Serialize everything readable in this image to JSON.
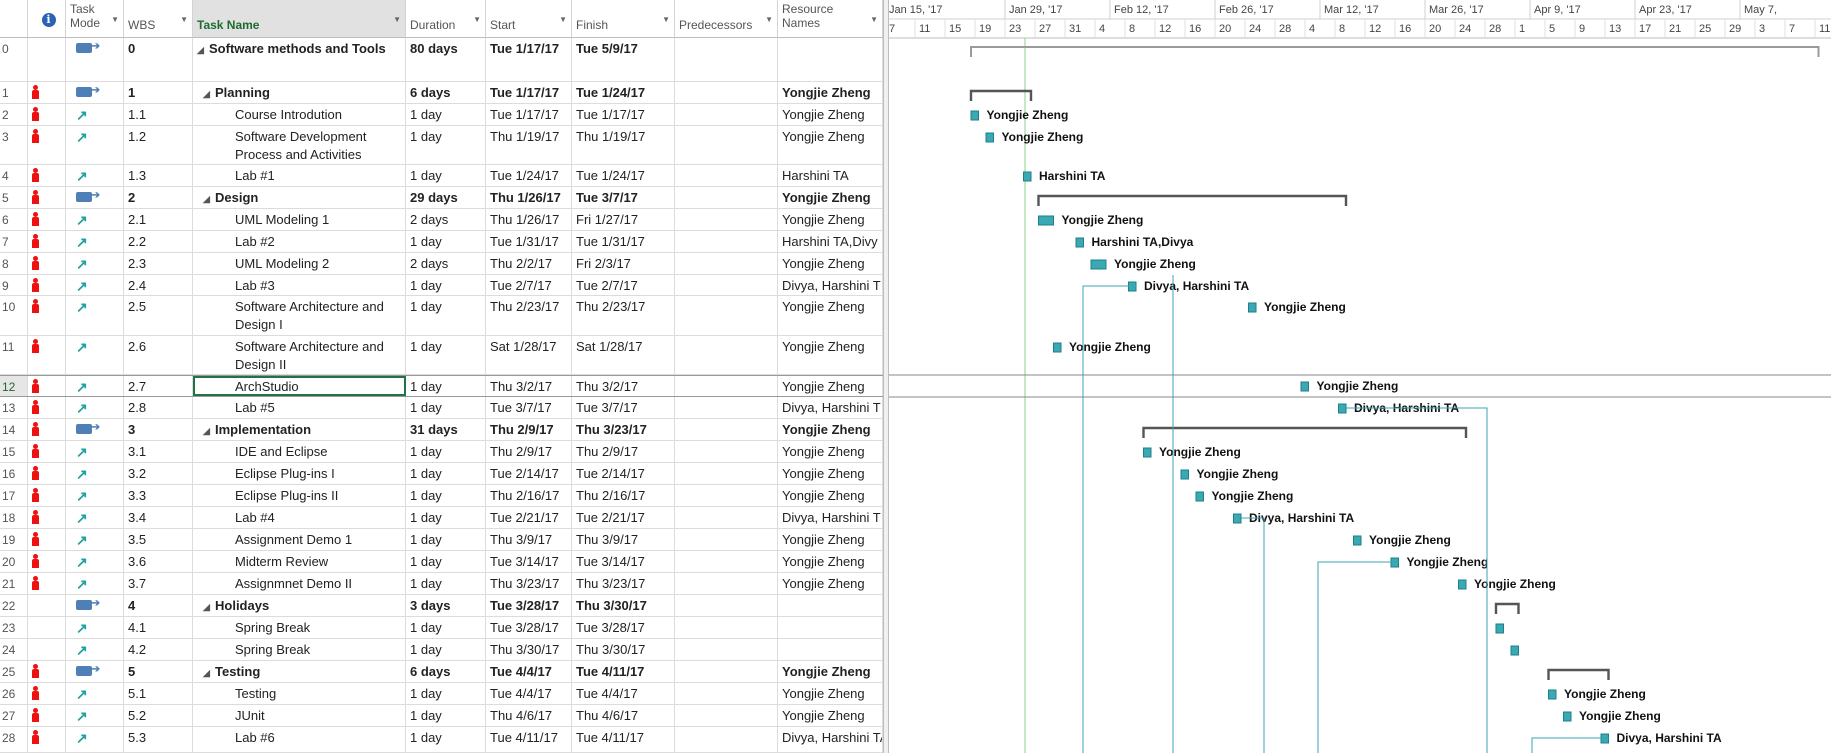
{
  "columns": {
    "task_mode": "Task Mode",
    "wbs": "WBS",
    "task_name": "Task Name",
    "duration": "Duration",
    "start": "Start",
    "finish": "Finish",
    "predecessors": "Predecessors",
    "resource_names": "Resource Names"
  },
  "timeline": {
    "major": [
      "Jan 15, '17",
      "Jan 29, '17",
      "Feb 12, '17",
      "Feb 26, '17",
      "Mar 12, '17",
      "Mar 26, '17",
      "Apr 9, '17",
      "Apr 23, '17",
      "May 7,"
    ],
    "minor": [
      "7",
      "11",
      "15",
      "19",
      "23",
      "27",
      "31",
      "4",
      "8",
      "12",
      "16",
      "20",
      "24",
      "28",
      "4",
      "8",
      "12",
      "16",
      "20",
      "24",
      "28",
      "1",
      "5",
      "9",
      "13",
      "17",
      "21",
      "25",
      "29",
      "3",
      "7",
      "11"
    ]
  },
  "tasks": [
    {
      "id": "0",
      "mode": "auto",
      "wbs": "0",
      "name": "Software methods and Tools",
      "duration": "80 days",
      "start": "Tue 1/17/17",
      "finish": "Tue 5/9/17",
      "resource": "",
      "summary": true,
      "indent": 0,
      "person": false
    },
    {
      "id": "1",
      "mode": "auto",
      "wbs": "1",
      "name": "Planning",
      "duration": "6 days",
      "start": "Tue 1/17/17",
      "finish": "Tue 1/24/17",
      "resource": "Yongjie Zheng",
      "summary": true,
      "indent": 1,
      "person": true
    },
    {
      "id": "2",
      "mode": "manual",
      "wbs": "1.1",
      "name": "Course Introdution",
      "duration": "1 day",
      "start": "Tue 1/17/17",
      "finish": "Tue 1/17/17",
      "resource": "Yongjie Zheng",
      "summary": false,
      "indent": 2,
      "person": true
    },
    {
      "id": "3",
      "mode": "manual",
      "wbs": "1.2",
      "name": "Software Development Process and Activities",
      "duration": "1 day",
      "start": "Thu 1/19/17",
      "finish": "Thu 1/19/17",
      "resource": "Yongjie Zheng",
      "summary": false,
      "indent": 2,
      "person": true
    },
    {
      "id": "4",
      "mode": "manual",
      "wbs": "1.3",
      "name": "Lab #1",
      "duration": "1 day",
      "start": "Tue 1/24/17",
      "finish": "Tue 1/24/17",
      "resource": " Harshini TA",
      "summary": false,
      "indent": 2,
      "person": true
    },
    {
      "id": "5",
      "mode": "auto",
      "wbs": "2",
      "name": "Design",
      "duration": "29 days",
      "start": "Thu 1/26/17",
      "finish": "Tue 3/7/17",
      "resource": "Yongjie Zheng",
      "summary": true,
      "indent": 1,
      "person": true
    },
    {
      "id": "6",
      "mode": "manual",
      "wbs": "2.1",
      "name": "UML Modeling 1",
      "duration": "2 days",
      "start": "Thu 1/26/17",
      "finish": "Fri 1/27/17",
      "resource": "Yongjie Zheng",
      "summary": false,
      "indent": 2,
      "person": true
    },
    {
      "id": "7",
      "mode": "manual",
      "wbs": "2.2",
      "name": "Lab #2",
      "duration": "1 day",
      "start": "Tue 1/31/17",
      "finish": "Tue 1/31/17",
      "resource": " Harshini TA,Divy",
      "summary": false,
      "indent": 2,
      "person": true
    },
    {
      "id": "8",
      "mode": "manual",
      "wbs": "2.3",
      "name": "UML Modeling 2",
      "duration": "2 days",
      "start": "Thu 2/2/17",
      "finish": "Fri 2/3/17",
      "resource": "Yongjie Zheng",
      "summary": false,
      "indent": 2,
      "person": true
    },
    {
      "id": "9",
      "mode": "manual",
      "wbs": "2.4",
      "name": "Lab #3",
      "duration": "1 day",
      "start": "Tue 2/7/17",
      "finish": "Tue 2/7/17",
      "resource": "Divya, Harshini T",
      "summary": false,
      "indent": 2,
      "person": true
    },
    {
      "id": "10",
      "mode": "manual",
      "wbs": "2.5",
      "name": "Software Architecture and Design I",
      "duration": "1 day",
      "start": "Thu 2/23/17",
      "finish": "Thu 2/23/17",
      "resource": "Yongjie Zheng",
      "summary": false,
      "indent": 2,
      "person": true
    },
    {
      "id": "11",
      "mode": "manual",
      "wbs": "2.6",
      "name": "Software Architecture and Design II",
      "duration": "1 day",
      "start": "Sat 1/28/17",
      "finish": "Sat 1/28/17",
      "resource": "Yongjie Zheng",
      "summary": false,
      "indent": 2,
      "person": true
    },
    {
      "id": "12",
      "mode": "manual",
      "wbs": "2.7",
      "name": "ArchStudio",
      "duration": "1 day",
      "start": "Thu 3/2/17",
      "finish": "Thu 3/2/17",
      "resource": "Yongjie Zheng",
      "summary": false,
      "indent": 2,
      "person": true,
      "selected": true
    },
    {
      "id": "13",
      "mode": "manual",
      "wbs": "2.8",
      "name": "Lab #5",
      "duration": "1 day",
      "start": "Tue 3/7/17",
      "finish": "Tue 3/7/17",
      "resource": "Divya, Harshini T",
      "summary": false,
      "indent": 2,
      "person": true
    },
    {
      "id": "14",
      "mode": "auto",
      "wbs": "3",
      "name": "Implementation",
      "duration": "31 days",
      "start": "Thu 2/9/17",
      "finish": "Thu 3/23/17",
      "resource": "Yongjie Zheng",
      "summary": true,
      "indent": 1,
      "person": true
    },
    {
      "id": "15",
      "mode": "manual",
      "wbs": "3.1",
      "name": "IDE and Eclipse",
      "duration": "1 day",
      "start": "Thu 2/9/17",
      "finish": "Thu 2/9/17",
      "resource": "Yongjie Zheng",
      "summary": false,
      "indent": 2,
      "person": true
    },
    {
      "id": "16",
      "mode": "manual",
      "wbs": "3.2",
      "name": "Eclipse Plug-ins I",
      "duration": "1 day",
      "start": "Tue 2/14/17",
      "finish": "Tue 2/14/17",
      "resource": "Yongjie Zheng",
      "summary": false,
      "indent": 2,
      "person": true
    },
    {
      "id": "17",
      "mode": "manual",
      "wbs": "3.3",
      "name": "Eclipse Plug-ins II",
      "duration": "1 day",
      "start": "Thu 2/16/17",
      "finish": "Thu 2/16/17",
      "resource": "Yongjie Zheng",
      "summary": false,
      "indent": 2,
      "person": true
    },
    {
      "id": "18",
      "mode": "manual",
      "wbs": "3.4",
      "name": "Lab #4",
      "duration": "1 day",
      "start": "Tue 2/21/17",
      "finish": "Tue 2/21/17",
      "resource": "Divya, Harshini T",
      "summary": false,
      "indent": 2,
      "person": true
    },
    {
      "id": "19",
      "mode": "manual",
      "wbs": "3.5",
      "name": "Assignment Demo 1",
      "duration": "1 day",
      "start": "Thu 3/9/17",
      "finish": "Thu 3/9/17",
      "resource": "Yongjie Zheng",
      "summary": false,
      "indent": 2,
      "person": true
    },
    {
      "id": "20",
      "mode": "manual",
      "wbs": "3.6",
      "name": "Midterm Review",
      "duration": "1 day",
      "start": "Tue 3/14/17",
      "finish": "Tue 3/14/17",
      "resource": "Yongjie Zheng",
      "summary": false,
      "indent": 2,
      "person": true
    },
    {
      "id": "21",
      "mode": "manual",
      "wbs": "3.7",
      "name": "Assignmnet Demo II",
      "duration": "1 day",
      "start": "Thu 3/23/17",
      "finish": "Thu 3/23/17",
      "resource": "Yongjie Zheng",
      "summary": false,
      "indent": 2,
      "person": true
    },
    {
      "id": "22",
      "mode": "auto",
      "wbs": "4",
      "name": "Holidays",
      "duration": "3 days",
      "start": "Tue 3/28/17",
      "finish": "Thu 3/30/17",
      "resource": "",
      "summary": true,
      "indent": 1,
      "person": false
    },
    {
      "id": "23",
      "mode": "manual",
      "wbs": "4.1",
      "name": "Spring Break",
      "duration": "1 day",
      "start": "Tue 3/28/17",
      "finish": "Tue 3/28/17",
      "resource": "",
      "summary": false,
      "indent": 2,
      "person": false
    },
    {
      "id": "24",
      "mode": "manual",
      "wbs": "4.2",
      "name": "Spring Break",
      "duration": "1 day",
      "start": "Thu 3/30/17",
      "finish": "Thu 3/30/17",
      "resource": "",
      "summary": false,
      "indent": 2,
      "person": false
    },
    {
      "id": "25",
      "mode": "auto",
      "wbs": "5",
      "name": "Testing",
      "duration": "6 days",
      "start": "Tue 4/4/17",
      "finish": "Tue 4/11/17",
      "resource": "Yongjie Zheng",
      "summary": true,
      "indent": 1,
      "person": true
    },
    {
      "id": "26",
      "mode": "manual",
      "wbs": "5.1",
      "name": "Testing",
      "duration": "1 day",
      "start": "Tue 4/4/17",
      "finish": "Tue 4/4/17",
      "resource": "Yongjie Zheng",
      "summary": false,
      "indent": 2,
      "person": true
    },
    {
      "id": "27",
      "mode": "manual",
      "wbs": "5.2",
      "name": "JUnit",
      "duration": "1 day",
      "start": "Thu 4/6/17",
      "finish": "Thu 4/6/17",
      "resource": "Yongjie Zheng",
      "summary": false,
      "indent": 2,
      "person": true
    },
    {
      "id": "28",
      "mode": "manual",
      "wbs": "5.3",
      "name": "Lab #6",
      "duration": "1 day",
      "start": "Tue 4/11/17",
      "finish": "Tue 4/11/17",
      "resource": "Divya, Harshini TA",
      "summary": false,
      "indent": 2,
      "person": true
    }
  ],
  "gantt_labels": {
    "2": "Yongjie Zheng",
    "3": "Yongjie Zheng",
    "4": "Harshini TA",
    "6": "Yongjie Zheng",
    "7": "Harshini TA,Divya",
    "8": "Yongjie Zheng",
    "9": "Divya, Harshini TA",
    "10": "Yongjie Zheng",
    "11": "Yongjie Zheng",
    "12": "Yongjie Zheng",
    "13": "Divya, Harshini TA",
    "15": "Yongjie Zheng",
    "16": "Yongjie Zheng",
    "17": "Yongjie Zheng",
    "18": "Divya, Harshini TA",
    "19": "Yongjie Zheng",
    "20": "Yongjie Zheng",
    "21": "Yongjie Zheng",
    "26": "Yongjie Zheng",
    "27": "Yongjie Zheng",
    "28": "Divya, Harshini TA"
  },
  "colors": {
    "bar": "#3aa9b4",
    "bar_dark": "#1c7f8a",
    "summary": "#555555",
    "link": "#38a6b0",
    "today_line": "#8fd18f",
    "selected_border": "#217346",
    "resource_icon": "#ee1111"
  }
}
